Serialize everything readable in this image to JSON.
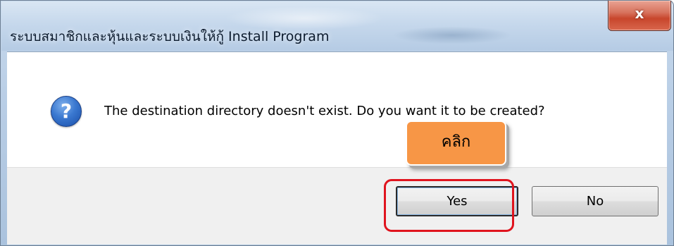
{
  "window": {
    "title": "ระบบสมาชิกและหุ้นและระบบเงินให้กู้ Install Program",
    "close_glyph": "x"
  },
  "dialog": {
    "icon": "question-icon",
    "icon_glyph": "?",
    "message": "The destination directory doesn't exist. Do you want it to be created?",
    "buttons": {
      "yes_label": "Yes",
      "no_label": "No"
    }
  },
  "annotation": {
    "callout_text": "คลิก",
    "callout_color": "#f79646",
    "highlight_color": "#e0141e"
  }
}
